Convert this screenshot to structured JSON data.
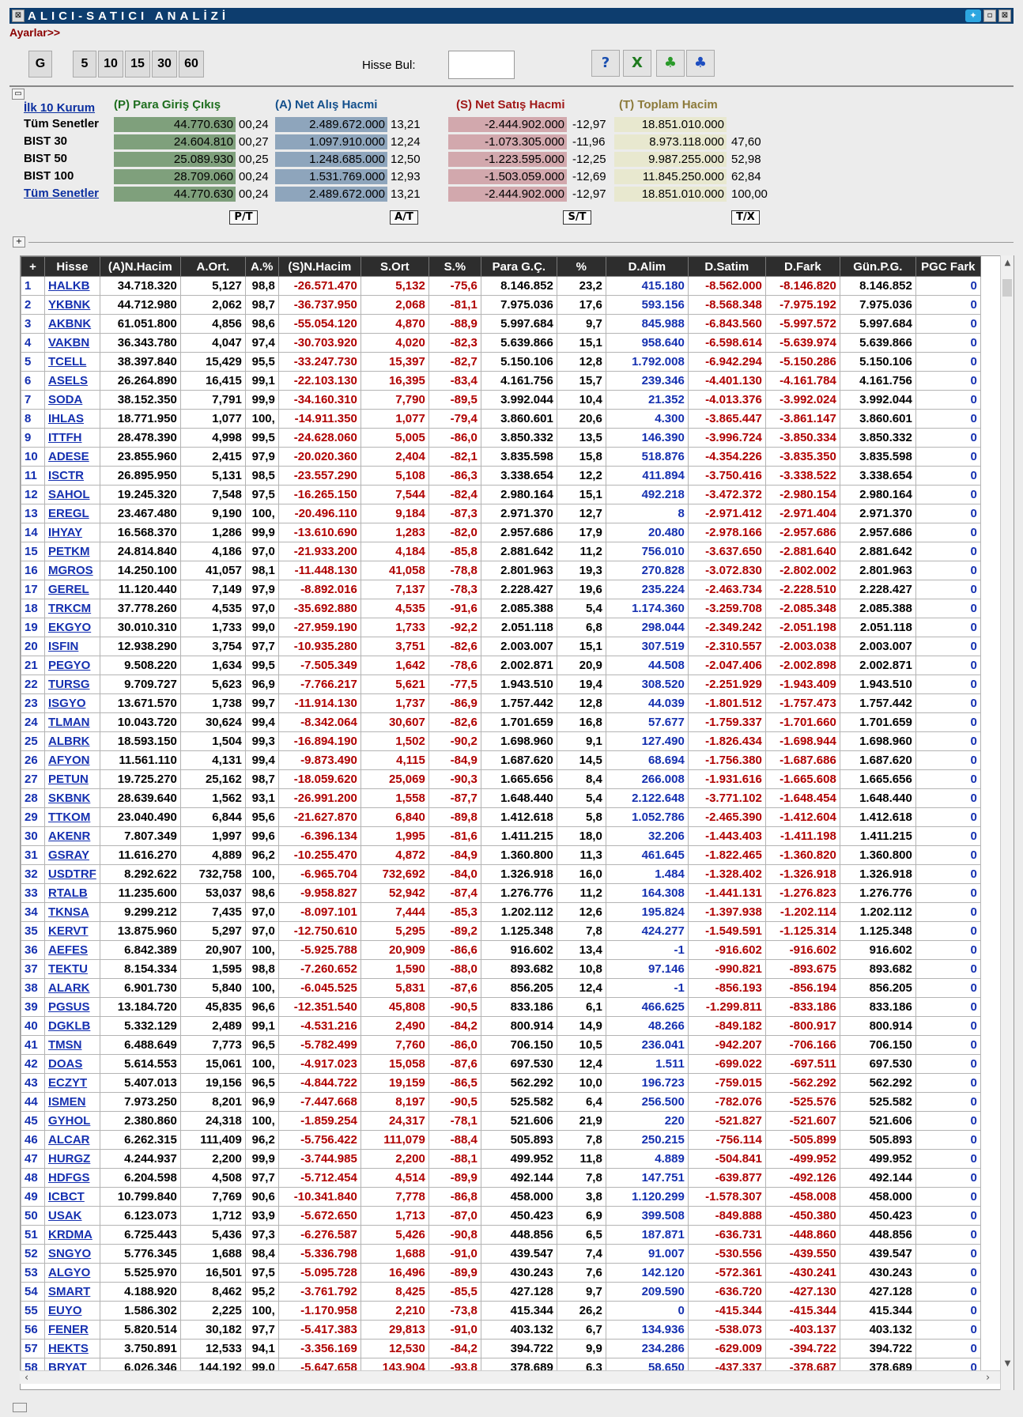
{
  "window": {
    "title": "ALICI-SATICI ANALİZİ",
    "settings_link": "Ayarlar>>"
  },
  "toolbar": {
    "period_buttons": [
      "G",
      "5",
      "10",
      "15",
      "30",
      "60"
    ],
    "find_label": "Hisse Bul:",
    "find_value": "",
    "icons": [
      "help-icon",
      "excel-icon",
      "group-green-icon",
      "group-blue-icon"
    ]
  },
  "summary": {
    "top10_link": "İlk 10 Kurum",
    "headers": {
      "p": "(P) Para Giriş Çıkış",
      "a": "(A) Net Alış Hacmi",
      "s": "(S) Net Satış Hacmi",
      "t": "(T) Toplam Hacim"
    },
    "rows": [
      {
        "label": "Tüm Senetler",
        "p": "44.770.630",
        "p_pct": "00,24",
        "a": "2.489.672.000",
        "a_pct": "13,21",
        "s": "-2.444.902.000",
        "s_pct": "-12,97",
        "t": "18.851.010.000",
        "t_pct": ""
      },
      {
        "label": "BIST 30",
        "p": "24.604.810",
        "p_pct": "00,27",
        "a": "1.097.910.000",
        "a_pct": "12,24",
        "s": "-1.073.305.000",
        "s_pct": "-11,96",
        "t": "8.973.118.000",
        "t_pct": "47,60"
      },
      {
        "label": "BIST 50",
        "p": "25.089.930",
        "p_pct": "00,25",
        "a": "1.248.685.000",
        "a_pct": "12,50",
        "s": "-1.223.595.000",
        "s_pct": "-12,25",
        "t": "9.987.255.000",
        "t_pct": "52,98"
      },
      {
        "label": "BIST 100",
        "p": "28.709.060",
        "p_pct": "00,24",
        "a": "1.531.769.000",
        "a_pct": "12,93",
        "s": "-1.503.059.000",
        "s_pct": "-12,69",
        "t": "11.845.250.000",
        "t_pct": "62,84"
      },
      {
        "label": "Tüm Senetler",
        "p": "44.770.630",
        "p_pct": "00,24",
        "a": "2.489.672.000",
        "a_pct": "13,21",
        "s": "-2.444.902.000",
        "s_pct": "-12,97",
        "t": "18.851.010.000",
        "t_pct": "100,00"
      }
    ],
    "buttons": [
      "P/T",
      "A/T",
      "S/T",
      "T/X"
    ]
  },
  "grid": {
    "columns": [
      "+",
      "Hisse",
      "(A)N.Hacim",
      "A.Ort.",
      "A.%",
      "(S)N.Hacim",
      "S.Ort",
      "S.%",
      "Para G.Ç.",
      "%",
      "D.Alim",
      "D.Satim",
      "D.Fark",
      "Gün.P.G.",
      "PGC Fark"
    ],
    "rows": [
      [
        "1",
        "HALKB",
        "34.718.320",
        "5,127",
        "98,8",
        "-26.571.470",
        "5,132",
        "-75,6",
        "8.146.852",
        "23,2",
        "415.180",
        "-8.562.000",
        "-8.146.820",
        "8.146.852",
        "0"
      ],
      [
        "2",
        "YKBNK",
        "44.712.980",
        "2,062",
        "98,7",
        "-36.737.950",
        "2,068",
        "-81,1",
        "7.975.036",
        "17,6",
        "593.156",
        "-8.568.348",
        "-7.975.192",
        "7.975.036",
        "0"
      ],
      [
        "3",
        "AKBNK",
        "61.051.800",
        "4,856",
        "98,6",
        "-55.054.120",
        "4,870",
        "-88,9",
        "5.997.684",
        "9,7",
        "845.988",
        "-6.843.560",
        "-5.997.572",
        "5.997.684",
        "0"
      ],
      [
        "4",
        "VAKBN",
        "36.343.780",
        "4,047",
        "97,4",
        "-30.703.920",
        "4,020",
        "-82,3",
        "5.639.866",
        "15,1",
        "958.640",
        "-6.598.614",
        "-5.639.974",
        "5.639.866",
        "0"
      ],
      [
        "5",
        "TCELL",
        "38.397.840",
        "15,429",
        "95,5",
        "-33.247.730",
        "15,397",
        "-82,7",
        "5.150.106",
        "12,8",
        "1.792.008",
        "-6.942.294",
        "-5.150.286",
        "5.150.106",
        "0"
      ],
      [
        "6",
        "ASELS",
        "26.264.890",
        "16,415",
        "99,1",
        "-22.103.130",
        "16,395",
        "-83,4",
        "4.161.756",
        "15,7",
        "239.346",
        "-4.401.130",
        "-4.161.784",
        "4.161.756",
        "0"
      ],
      [
        "7",
        "SODA",
        "38.152.350",
        "7,791",
        "99,9",
        "-34.160.310",
        "7,790",
        "-89,5",
        "3.992.044",
        "10,4",
        "21.352",
        "-4.013.376",
        "-3.992.024",
        "3.992.044",
        "0"
      ],
      [
        "8",
        "IHLAS",
        "18.771.950",
        "1,077",
        "100,",
        "-14.911.350",
        "1,077",
        "-79,4",
        "3.860.601",
        "20,6",
        "4.300",
        "-3.865.447",
        "-3.861.147",
        "3.860.601",
        "0"
      ],
      [
        "9",
        "ITTFH",
        "28.478.390",
        "4,998",
        "99,5",
        "-24.628.060",
        "5,005",
        "-86,0",
        "3.850.332",
        "13,5",
        "146.390",
        "-3.996.724",
        "-3.850.334",
        "3.850.332",
        "0"
      ],
      [
        "10",
        "ADESE",
        "23.855.960",
        "2,415",
        "97,9",
        "-20.020.360",
        "2,404",
        "-82,1",
        "3.835.598",
        "15,8",
        "518.876",
        "-4.354.226",
        "-3.835.350",
        "3.835.598",
        "0"
      ],
      [
        "11",
        "ISCTR",
        "26.895.950",
        "5,131",
        "98,5",
        "-23.557.290",
        "5,108",
        "-86,3",
        "3.338.654",
        "12,2",
        "411.894",
        "-3.750.416",
        "-3.338.522",
        "3.338.654",
        "0"
      ],
      [
        "12",
        "SAHOL",
        "19.245.320",
        "7,548",
        "97,5",
        "-16.265.150",
        "7,544",
        "-82,4",
        "2.980.164",
        "15,1",
        "492.218",
        "-3.472.372",
        "-2.980.154",
        "2.980.164",
        "0"
      ],
      [
        "13",
        "EREGL",
        "23.467.480",
        "9,190",
        "100,",
        "-20.496.110",
        "9,184",
        "-87,3",
        "2.971.370",
        "12,7",
        "8",
        "-2.971.412",
        "-2.971.404",
        "2.971.370",
        "0"
      ],
      [
        "14",
        "IHYAY",
        "16.568.370",
        "1,286",
        "99,9",
        "-13.610.690",
        "1,283",
        "-82,0",
        "2.957.686",
        "17,9",
        "20.480",
        "-2.978.166",
        "-2.957.686",
        "2.957.686",
        "0"
      ],
      [
        "15",
        "PETKM",
        "24.814.840",
        "4,186",
        "97,0",
        "-21.933.200",
        "4,184",
        "-85,8",
        "2.881.642",
        "11,2",
        "756.010",
        "-3.637.650",
        "-2.881.640",
        "2.881.642",
        "0"
      ],
      [
        "16",
        "MGROS",
        "14.250.100",
        "41,057",
        "98,1",
        "-11.448.130",
        "41,058",
        "-78,8",
        "2.801.963",
        "19,3",
        "270.828",
        "-3.072.830",
        "-2.802.002",
        "2.801.963",
        "0"
      ],
      [
        "17",
        "GEREL",
        "11.120.440",
        "7,149",
        "97,9",
        "-8.892.016",
        "7,137",
        "-78,3",
        "2.228.427",
        "19,6",
        "235.224",
        "-2.463.734",
        "-2.228.510",
        "2.228.427",
        "0"
      ],
      [
        "18",
        "TRKCM",
        "37.778.260",
        "4,535",
        "97,0",
        "-35.692.880",
        "4,535",
        "-91,6",
        "2.085.388",
        "5,4",
        "1.174.360",
        "-3.259.708",
        "-2.085.348",
        "2.085.388",
        "0"
      ],
      [
        "19",
        "EKGYO",
        "30.010.310",
        "1,733",
        "99,0",
        "-27.959.190",
        "1,733",
        "-92,2",
        "2.051.118",
        "6,8",
        "298.044",
        "-2.349.242",
        "-2.051.198",
        "2.051.118",
        "0"
      ],
      [
        "20",
        "ISFIN",
        "12.938.290",
        "3,754",
        "97,7",
        "-10.935.280",
        "3,751",
        "-82,6",
        "2.003.007",
        "15,1",
        "307.519",
        "-2.310.557",
        "-2.003.038",
        "2.003.007",
        "0"
      ],
      [
        "21",
        "PEGYO",
        "9.508.220",
        "1,634",
        "99,5",
        "-7.505.349",
        "1,642",
        "-78,6",
        "2.002.871",
        "20,9",
        "44.508",
        "-2.047.406",
        "-2.002.898",
        "2.002.871",
        "0"
      ],
      [
        "22",
        "TURSG",
        "9.709.727",
        "5,623",
        "96,9",
        "-7.766.217",
        "5,621",
        "-77,5",
        "1.943.510",
        "19,4",
        "308.520",
        "-2.251.929",
        "-1.943.409",
        "1.943.510",
        "0"
      ],
      [
        "23",
        "ISGYO",
        "13.671.570",
        "1,738",
        "99,7",
        "-11.914.130",
        "1,737",
        "-86,9",
        "1.757.442",
        "12,8",
        "44.039",
        "-1.801.512",
        "-1.757.473",
        "1.757.442",
        "0"
      ],
      [
        "24",
        "TLMAN",
        "10.043.720",
        "30,624",
        "99,4",
        "-8.342.064",
        "30,607",
        "-82,6",
        "1.701.659",
        "16,8",
        "57.677",
        "-1.759.337",
        "-1.701.660",
        "1.701.659",
        "0"
      ],
      [
        "25",
        "ALBRK",
        "18.593.150",
        "1,504",
        "99,3",
        "-16.894.190",
        "1,502",
        "-90,2",
        "1.698.960",
        "9,1",
        "127.490",
        "-1.826.434",
        "-1.698.944",
        "1.698.960",
        "0"
      ],
      [
        "26",
        "AFYON",
        "11.561.110",
        "4,131",
        "99,4",
        "-9.873.490",
        "4,115",
        "-84,9",
        "1.687.620",
        "14,5",
        "68.694",
        "-1.756.380",
        "-1.687.686",
        "1.687.620",
        "0"
      ],
      [
        "27",
        "PETUN",
        "19.725.270",
        "25,162",
        "98,7",
        "-18.059.620",
        "25,069",
        "-90,3",
        "1.665.656",
        "8,4",
        "266.008",
        "-1.931.616",
        "-1.665.608",
        "1.665.656",
        "0"
      ],
      [
        "28",
        "SKBNK",
        "28.639.640",
        "1,562",
        "93,1",
        "-26.991.200",
        "1,558",
        "-87,7",
        "1.648.440",
        "5,4",
        "2.122.648",
        "-3.771.102",
        "-1.648.454",
        "1.648.440",
        "0"
      ],
      [
        "29",
        "TTKOM",
        "23.040.490",
        "6,844",
        "95,6",
        "-21.627.870",
        "6,840",
        "-89,8",
        "1.412.618",
        "5,8",
        "1.052.786",
        "-2.465.390",
        "-1.412.604",
        "1.412.618",
        "0"
      ],
      [
        "30",
        "AKENR",
        "7.807.349",
        "1,997",
        "99,6",
        "-6.396.134",
        "1,995",
        "-81,6",
        "1.411.215",
        "18,0",
        "32.206",
        "-1.443.403",
        "-1.411.198",
        "1.411.215",
        "0"
      ],
      [
        "31",
        "GSRAY",
        "11.616.270",
        "4,889",
        "96,2",
        "-10.255.470",
        "4,872",
        "-84,9",
        "1.360.800",
        "11,3",
        "461.645",
        "-1.822.465",
        "-1.360.820",
        "1.360.800",
        "0"
      ],
      [
        "32",
        "USDTRF",
        "8.292.622",
        "732,758",
        "100,",
        "-6.965.704",
        "732,692",
        "-84,0",
        "1.326.918",
        "16,0",
        "1.484",
        "-1.328.402",
        "-1.326.918",
        "1.326.918",
        "0"
      ],
      [
        "33",
        "RTALB",
        "11.235.600",
        "53,037",
        "98,6",
        "-9.958.827",
        "52,942",
        "-87,4",
        "1.276.776",
        "11,2",
        "164.308",
        "-1.441.131",
        "-1.276.823",
        "1.276.776",
        "0"
      ],
      [
        "34",
        "TKNSA",
        "9.299.212",
        "7,435",
        "97,0",
        "-8.097.101",
        "7,444",
        "-85,3",
        "1.202.112",
        "12,6",
        "195.824",
        "-1.397.938",
        "-1.202.114",
        "1.202.112",
        "0"
      ],
      [
        "35",
        "KERVT",
        "13.875.960",
        "5,297",
        "97,0",
        "-12.750.610",
        "5,295",
        "-89,2",
        "1.125.348",
        "7,8",
        "424.277",
        "-1.549.591",
        "-1.125.314",
        "1.125.348",
        "0"
      ],
      [
        "36",
        "AEFES",
        "6.842.389",
        "20,907",
        "100,",
        "-5.925.788",
        "20,909",
        "-86,6",
        "916.602",
        "13,4",
        "-1",
        "-916.602",
        "-916.602",
        "916.602",
        "0"
      ],
      [
        "37",
        "TEKTU",
        "8.154.334",
        "1,595",
        "98,8",
        "-7.260.652",
        "1,590",
        "-88,0",
        "893.682",
        "10,8",
        "97.146",
        "-990.821",
        "-893.675",
        "893.682",
        "0"
      ],
      [
        "38",
        "ALARK",
        "6.901.730",
        "5,840",
        "100,",
        "-6.045.525",
        "5,831",
        "-87,6",
        "856.205",
        "12,4",
        "-1",
        "-856.193",
        "-856.194",
        "856.205",
        "0"
      ],
      [
        "39",
        "PGSUS",
        "13.184.720",
        "45,835",
        "96,6",
        "-12.351.540",
        "45,808",
        "-90,5",
        "833.186",
        "6,1",
        "466.625",
        "-1.299.811",
        "-833.186",
        "833.186",
        "0"
      ],
      [
        "40",
        "DGKLB",
        "5.332.129",
        "2,489",
        "99,1",
        "-4.531.216",
        "2,490",
        "-84,2",
        "800.914",
        "14,9",
        "48.266",
        "-849.182",
        "-800.917",
        "800.914",
        "0"
      ],
      [
        "41",
        "TMSN",
        "6.488.649",
        "7,773",
        "96,5",
        "-5.782.499",
        "7,760",
        "-86,0",
        "706.150",
        "10,5",
        "236.041",
        "-942.207",
        "-706.166",
        "706.150",
        "0"
      ],
      [
        "42",
        "DOAS",
        "5.614.553",
        "15,061",
        "100,",
        "-4.917.023",
        "15,058",
        "-87,6",
        "697.530",
        "12,4",
        "1.511",
        "-699.022",
        "-697.511",
        "697.530",
        "0"
      ],
      [
        "43",
        "ECZYT",
        "5.407.013",
        "19,156",
        "96,5",
        "-4.844.722",
        "19,159",
        "-86,5",
        "562.292",
        "10,0",
        "196.723",
        "-759.015",
        "-562.292",
        "562.292",
        "0"
      ],
      [
        "44",
        "ISMEN",
        "7.973.250",
        "8,201",
        "96,9",
        "-7.447.668",
        "8,197",
        "-90,5",
        "525.582",
        "6,4",
        "256.500",
        "-782.076",
        "-525.576",
        "525.582",
        "0"
      ],
      [
        "45",
        "GYHOL",
        "2.380.860",
        "24,318",
        "100,",
        "-1.859.254",
        "24,317",
        "-78,1",
        "521.606",
        "21,9",
        "220",
        "-521.827",
        "-521.607",
        "521.606",
        "0"
      ],
      [
        "46",
        "ALCAR",
        "6.262.315",
        "111,409",
        "96,2",
        "-5.756.422",
        "111,079",
        "-88,4",
        "505.893",
        "7,8",
        "250.215",
        "-756.114",
        "-505.899",
        "505.893",
        "0"
      ],
      [
        "47",
        "HURGZ",
        "4.244.937",
        "2,200",
        "99,9",
        "-3.744.985",
        "2,200",
        "-88,1",
        "499.952",
        "11,8",
        "4.889",
        "-504.841",
        "-499.952",
        "499.952",
        "0"
      ],
      [
        "48",
        "HDFGS",
        "6.204.598",
        "4,508",
        "97,7",
        "-5.712.454",
        "4,514",
        "-89,9",
        "492.144",
        "7,8",
        "147.751",
        "-639.877",
        "-492.126",
        "492.144",
        "0"
      ],
      [
        "49",
        "ICBCT",
        "10.799.840",
        "7,769",
        "90,6",
        "-10.341.840",
        "7,778",
        "-86,8",
        "458.000",
        "3,8",
        "1.120.299",
        "-1.578.307",
        "-458.008",
        "458.000",
        "0"
      ],
      [
        "50",
        "USAK",
        "6.123.073",
        "1,712",
        "93,9",
        "-5.672.650",
        "1,713",
        "-87,0",
        "450.423",
        "6,9",
        "399.508",
        "-849.888",
        "-450.380",
        "450.423",
        "0"
      ],
      [
        "51",
        "KRDMA",
        "6.725.443",
        "5,436",
        "97,3",
        "-6.276.587",
        "5,426",
        "-90,8",
        "448.856",
        "6,5",
        "187.871",
        "-636.731",
        "-448.860",
        "448.856",
        "0"
      ],
      [
        "52",
        "SNGYO",
        "5.776.345",
        "1,688",
        "98,4",
        "-5.336.798",
        "1,688",
        "-91,0",
        "439.547",
        "7,4",
        "91.007",
        "-530.556",
        "-439.550",
        "439.547",
        "0"
      ],
      [
        "53",
        "ALGYO",
        "5.525.970",
        "16,501",
        "97,5",
        "-5.095.728",
        "16,496",
        "-89,9",
        "430.243",
        "7,6",
        "142.120",
        "-572.361",
        "-430.241",
        "430.243",
        "0"
      ],
      [
        "54",
        "SMART",
        "4.188.920",
        "8,462",
        "95,2",
        "-3.761.792",
        "8,425",
        "-85,5",
        "427.128",
        "9,7",
        "209.590",
        "-636.720",
        "-427.130",
        "427.128",
        "0"
      ],
      [
        "55",
        "EUYO",
        "1.586.302",
        "2,225",
        "100,",
        "-1.170.958",
        "2,210",
        "-73,8",
        "415.344",
        "26,2",
        "0",
        "-415.344",
        "-415.344",
        "415.344",
        "0"
      ],
      [
        "56",
        "FENER",
        "5.820.514",
        "30,182",
        "97,7",
        "-5.417.383",
        "29,813",
        "-91,0",
        "403.132",
        "6,7",
        "134.936",
        "-538.073",
        "-403.137",
        "403.132",
        "0"
      ],
      [
        "57",
        "HEKTS",
        "3.750.891",
        "12,533",
        "94,1",
        "-3.356.169",
        "12,530",
        "-84,2",
        "394.722",
        "9,9",
        "234.286",
        "-629.009",
        "-394.722",
        "394.722",
        "0"
      ],
      [
        "58",
        "BRYAT",
        "6.026.346",
        "144,192",
        "99,0",
        "-5.647.658",
        "143,904",
        "-93,8",
        "378.689",
        "6,3",
        "58.650",
        "-437.337",
        "-378.687",
        "378.689",
        "0"
      ]
    ]
  }
}
